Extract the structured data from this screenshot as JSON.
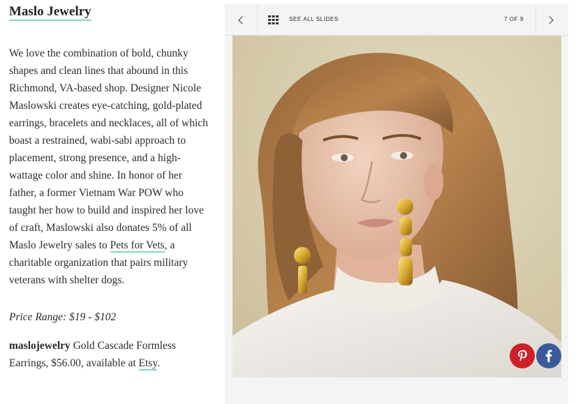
{
  "article": {
    "title": "Maslo Jewelry",
    "body_before_link": "We love the combination of bold, chunky shapes and clean lines that abound in this Richmond, VA-based shop. Designer Nicole Maslowski creates eye-catching, gold-plated earrings, bracelets and necklaces, all of which boast a restrained, wabi-sabi approach to placement, strong presence, and a high-wattage color and shine. In honor of her father, a former Vietnam War POW who taught her how to build and inspired her love of craft, Maslowski also donates 5% of all Maslo Jewelry sales to ",
    "link_text": "Pets for Vets",
    "body_after_link": ", a charitable organization that pairs military veterans with shelter dogs.",
    "price_range": "Price Range: $19 - $102",
    "product_brand": "maslojewelry",
    "product_text": " Gold Cascade Formless Earrings, $56.00, available at ",
    "product_link": "Etsy",
    "product_end": "."
  },
  "slideshow": {
    "see_all_label": "SEE ALL SLIDES",
    "counter": "7 OF 9",
    "current": 7,
    "total": 9,
    "prev_icon": "chevron-left-icon",
    "next_icon": "chevron-right-icon",
    "grid_icon": "grid-icon"
  },
  "share": {
    "pinterest_icon": "pinterest-icon",
    "pinterest_color": "#cb2027",
    "facebook_icon": "facebook-icon",
    "facebook_color": "#3b5a9a"
  },
  "colors": {
    "link_underline": "#7fd8c2",
    "toolbar_bg": "#f4f4f4"
  }
}
